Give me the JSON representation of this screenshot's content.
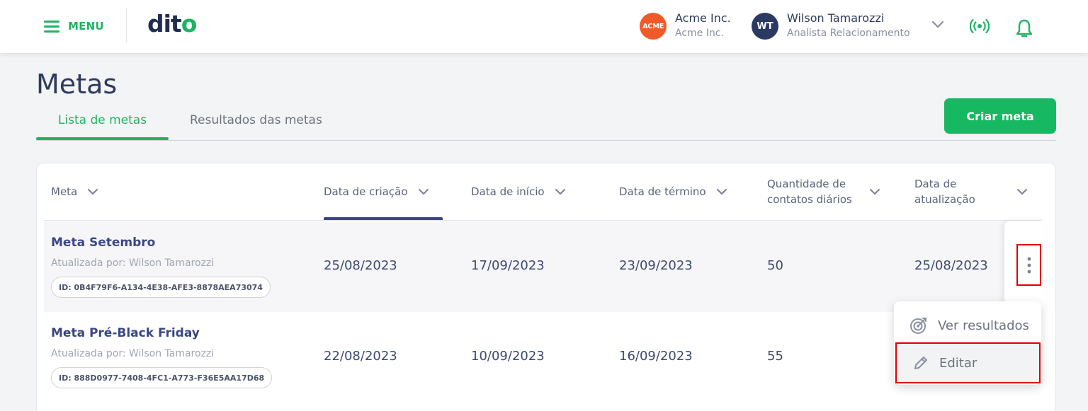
{
  "header": {
    "menu_label": "MENU",
    "logo_text": "dito",
    "company": {
      "avatar_text": "ACME",
      "name": "Acme Inc.",
      "sub": "Acme Inc."
    },
    "user": {
      "avatar_text": "WT",
      "name": "Wilson Tamarozzi",
      "role": "Analista Relacionamento"
    },
    "accent_color": "#1fb463"
  },
  "page": {
    "title": "Metas",
    "tabs": [
      {
        "label": "Lista de metas",
        "active": true
      },
      {
        "label": "Resultados das metas",
        "active": false
      }
    ],
    "create_button": "Criar meta"
  },
  "table": {
    "columns": [
      {
        "label": "Meta"
      },
      {
        "label": "Data de criação",
        "sorted": true
      },
      {
        "label": "Data de início"
      },
      {
        "label": "Data de término"
      },
      {
        "label": "Quantidade de contatos diários"
      },
      {
        "label": "Data de atualização"
      }
    ],
    "rows": [
      {
        "name": "Meta Setembro",
        "updated_by": "Atualizada por: Wilson Tamarozzi",
        "id": "ID: 0B4F79F6-A134-4E38-AFE3-8878AEA73074",
        "created": "25/08/2023",
        "start": "17/09/2023",
        "end": "23/09/2023",
        "daily": "50",
        "updated": "25/08/2023"
      },
      {
        "name": "Meta Pré-Black Friday",
        "updated_by": "Atualizada por: Wilson Tamarozzi",
        "id": "ID: 888D0977-7408-4FC1-A773-F36E5AA17D68",
        "created": "22/08/2023",
        "start": "10/09/2023",
        "end": "16/09/2023",
        "daily": "55",
        "updated": ""
      }
    ]
  },
  "row_menu": {
    "items": [
      {
        "label": "Ver resultados",
        "icon": "target-icon"
      },
      {
        "label": "Editar",
        "icon": "pencil-icon"
      }
    ]
  }
}
